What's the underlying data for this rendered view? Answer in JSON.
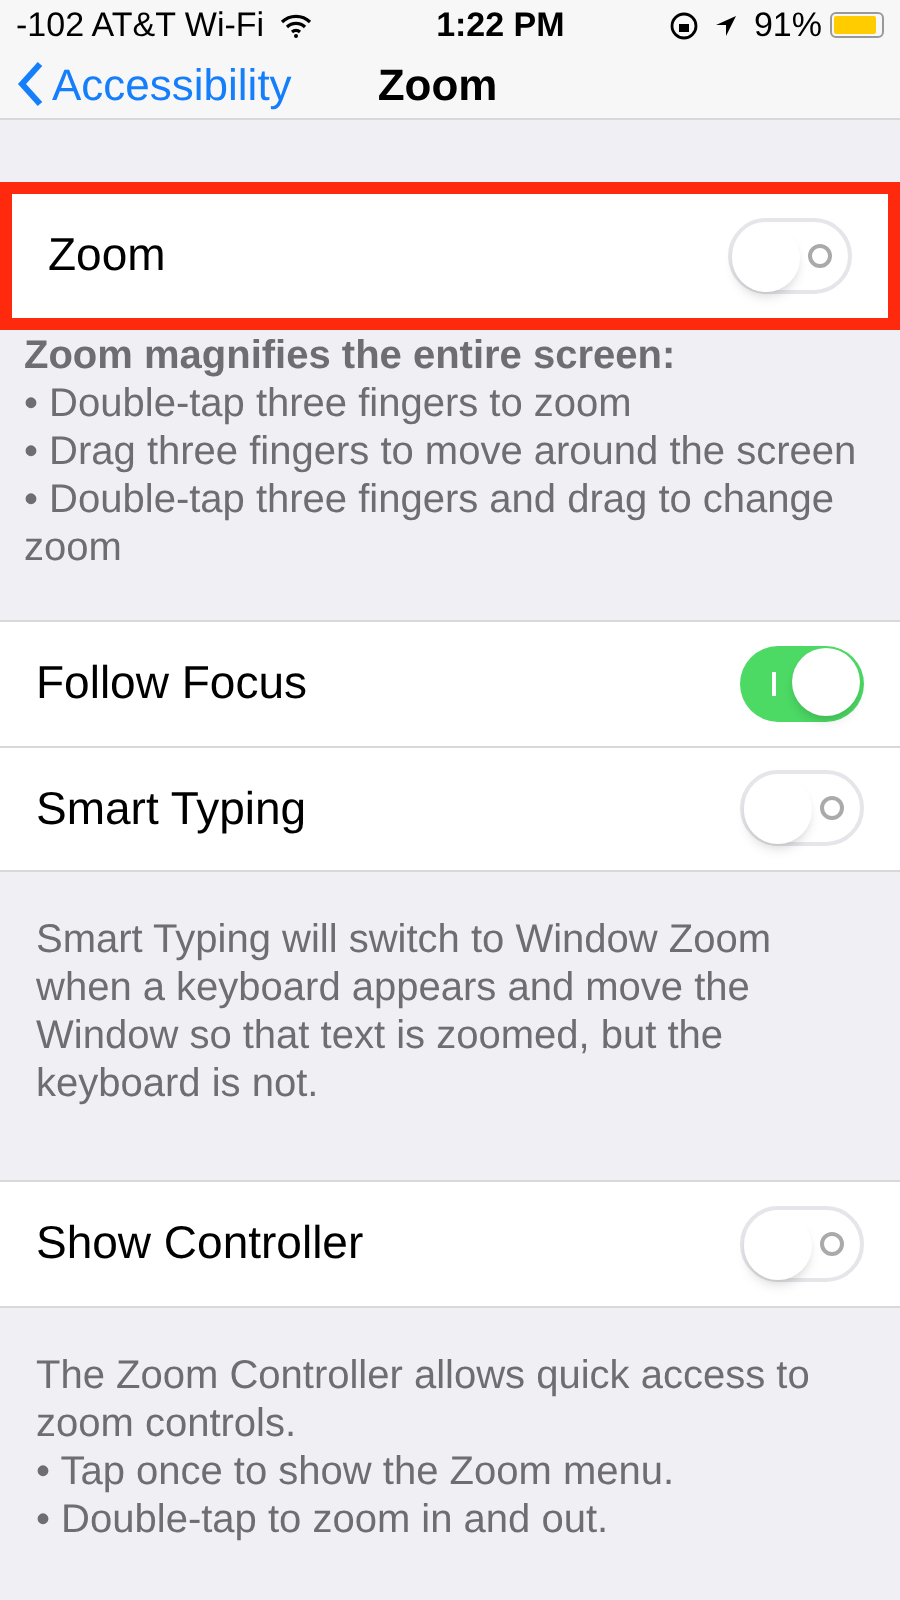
{
  "status_bar": {
    "carrier": "-102 AT&T Wi-Fi",
    "time": "1:22 PM",
    "battery": "91%"
  },
  "nav": {
    "back": "Accessibility",
    "title": "Zoom"
  },
  "groups": [
    {
      "rows": [
        {
          "label": "Zoom",
          "on": false,
          "highlighted": true
        }
      ],
      "footer": {
        "heading": "Zoom magnifies the entire screen:",
        "lines": [
          "• Double-tap three fingers to zoom",
          "• Drag three fingers to move around the screen",
          "• Double-tap three fingers and drag to change zoom"
        ]
      }
    },
    {
      "rows": [
        {
          "label": "Follow Focus",
          "on": true,
          "highlighted": false
        },
        {
          "label": "Smart Typing",
          "on": false,
          "highlighted": false
        }
      ],
      "footer": {
        "lines": [
          "Smart Typing will switch to Window Zoom when a keyboard appears and move the Window so that text is zoomed, but the keyboard is not."
        ]
      }
    },
    {
      "rows": [
        {
          "label": "Show Controller",
          "on": false,
          "highlighted": false
        }
      ],
      "footer": {
        "lines": [
          "The Zoom Controller allows quick access to zoom controls.",
          "• Tap once to show the Zoom menu.",
          "• Double-tap to zoom in and out."
        ]
      }
    }
  ]
}
